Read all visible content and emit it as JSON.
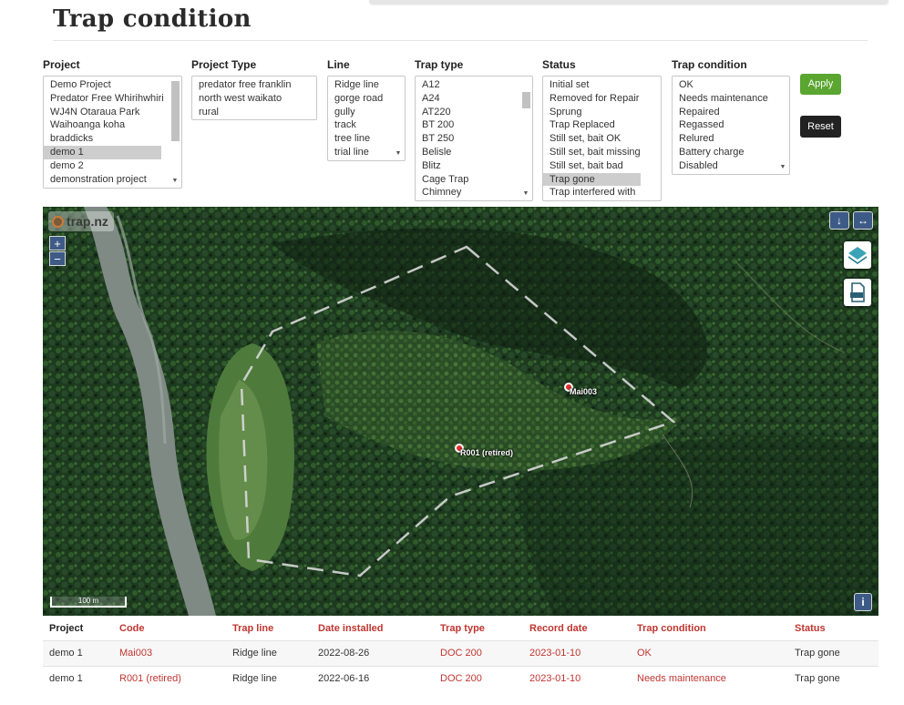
{
  "page": {
    "title": "Trap condition"
  },
  "filters": {
    "project": {
      "label": "Project",
      "options": [
        "Demo Project",
        "Predator Free Whirihwhiri",
        "WJ4N Otaraua Park",
        "Waihoanga koha",
        "braddicks",
        "demo 1",
        "demo 2",
        "demonstration project"
      ],
      "selected": "demo 1"
    },
    "project_type": {
      "label": "Project Type",
      "options": [
        "predator free franklin",
        "north west waikato",
        "rural"
      ]
    },
    "line": {
      "label": "Line",
      "options": [
        "Ridge line",
        "gorge road",
        "gully",
        "track",
        "tree line",
        "trial line"
      ]
    },
    "trap_type": {
      "label": "Trap type",
      "options": [
        "A12",
        "A24",
        "AT220",
        "BT 200",
        "BT 250",
        "Belisle",
        "Blitz",
        "Cage Trap",
        "Chimney"
      ]
    },
    "status": {
      "label": "Status",
      "options": [
        "Initial set",
        "Removed for Repair",
        "Sprung",
        "Trap Replaced",
        "Still set, bait OK",
        "Still set, bait missing",
        "Still set, bait bad",
        "Trap gone",
        "Trap interfered with"
      ],
      "selected": "Trap gone"
    },
    "trap_condition": {
      "label": "Trap condition",
      "options": [
        "OK",
        "Needs maintenance",
        "Repaired",
        "Regassed",
        "Relured",
        "Battery charge",
        "Disabled"
      ]
    }
  },
  "buttons": {
    "apply": "Apply",
    "reset": "Reset"
  },
  "map": {
    "brand": "trap.nz",
    "zoom_in": "+",
    "zoom_out": "−",
    "scale_label": "100 m",
    "info": "i",
    "markers": [
      {
        "label": "Mai003"
      },
      {
        "label": "R001 (retired)"
      }
    ]
  },
  "table": {
    "headers": {
      "project": "Project",
      "code": "Code",
      "trap_line": "Trap line",
      "date_installed": "Date installed",
      "trap_type": "Trap type",
      "record_date": "Record date",
      "trap_condition": "Trap condition",
      "status": "Status"
    },
    "rows": [
      {
        "project": "demo 1",
        "code": "Mai003",
        "trap_line": "Ridge line",
        "date_installed": "2022-08-26",
        "trap_type": "DOC 200",
        "record_date": "2023-01-10",
        "trap_condition": "OK",
        "status": "Trap gone"
      },
      {
        "project": "demo 1",
        "code": "R001 (retired)",
        "trap_line": "Ridge line",
        "date_installed": "2022-06-16",
        "trap_type": "DOC 200",
        "record_date": "2023-01-10",
        "trap_condition": "Needs maintenance",
        "status": "Trap gone"
      }
    ]
  },
  "colors": {
    "accent_red": "#c03530",
    "apply_green": "#5aa630",
    "map_control_blue": "#3d5b86"
  }
}
